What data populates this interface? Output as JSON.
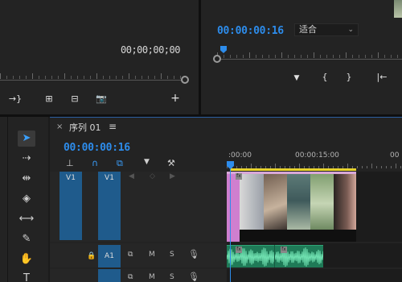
{
  "source_monitor": {
    "timecode": "00;00;00;00",
    "controls": [
      "→}",
      "⊞",
      "⊟",
      "📷",
      "+"
    ]
  },
  "program_monitor": {
    "timecode": "00:00:00:16",
    "fit_select": {
      "value": "适合"
    },
    "controls": [
      "▼",
      "{",
      "}",
      "|←"
    ]
  },
  "timeline": {
    "tab_label": "序列 01",
    "close_glyph": "×",
    "menu_glyph": "≡",
    "timecode": "00:00:00:16",
    "ruler_labels": [
      ":00:00",
      "00:00:15:00",
      "00"
    ],
    "tracks": {
      "v1": {
        "label": "V1",
        "target_label": "V1"
      },
      "a1": {
        "target_label": "A1",
        "mute": "M",
        "solo": "S"
      },
      "a2": {
        "mute": "M",
        "solo": "S"
      }
    }
  },
  "tools": [
    "selection",
    "track-select",
    "ripple-edit",
    "razor",
    "slip",
    "pen",
    "hand",
    "type"
  ],
  "colors": {
    "accent": "#2d8ceb",
    "work_area": "#e6d22c",
    "video_clip": "#cf7fcf",
    "audio_clip": "#1f7a57",
    "target": "#1f5b8c"
  }
}
